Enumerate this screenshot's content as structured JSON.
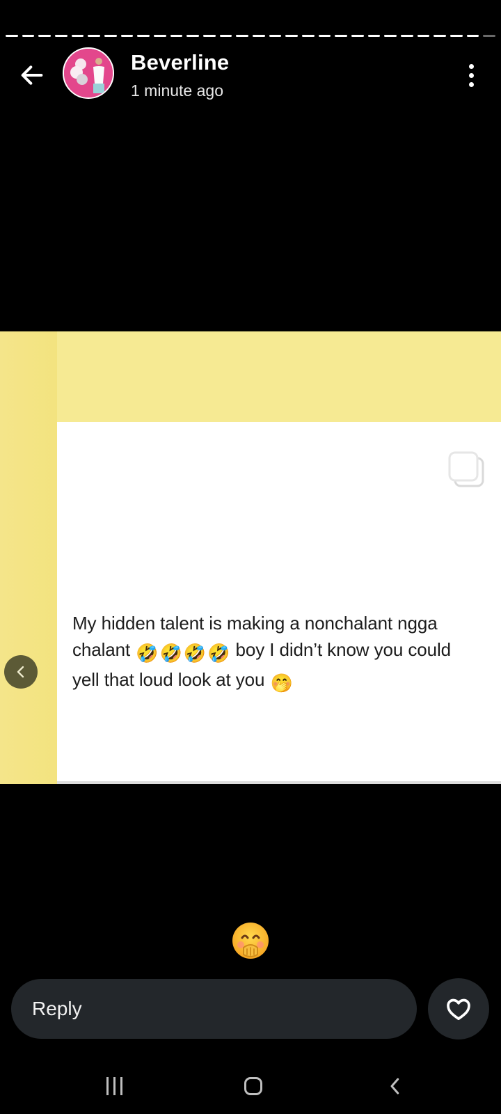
{
  "story": {
    "segments_total": 30,
    "segments_viewed": 29
  },
  "header": {
    "author_name": "Beverline",
    "timestamp": "1 minute ago",
    "back_icon": "arrow-left-icon",
    "menu_icon": "more-vertical-icon",
    "avatar_colors": [
      "#e3478c",
      "#f3d4e2"
    ]
  },
  "media": {
    "tweet": {
      "line1": "My hidden talent is making a nonchalant ngga",
      "line2_prefix": "chalant ",
      "line2_suffix": " boy I didn’t know you could",
      "line3": "yell that loud look at you ",
      "emojis": {
        "rofl": "🤣",
        "hand_over_mouth": "🤭"
      }
    },
    "colors": {
      "background": "#f6ea93",
      "card": "#ffffff",
      "text": "#1c1c1c"
    }
  },
  "reaction": {
    "emoji": "🤭"
  },
  "reply_bar": {
    "placeholder": "Reply",
    "like_icon": "heart-outline-icon"
  },
  "navbar": {
    "recents_icon": "recents-icon",
    "home_icon": "home-icon",
    "back_icon": "nav-back-icon"
  }
}
